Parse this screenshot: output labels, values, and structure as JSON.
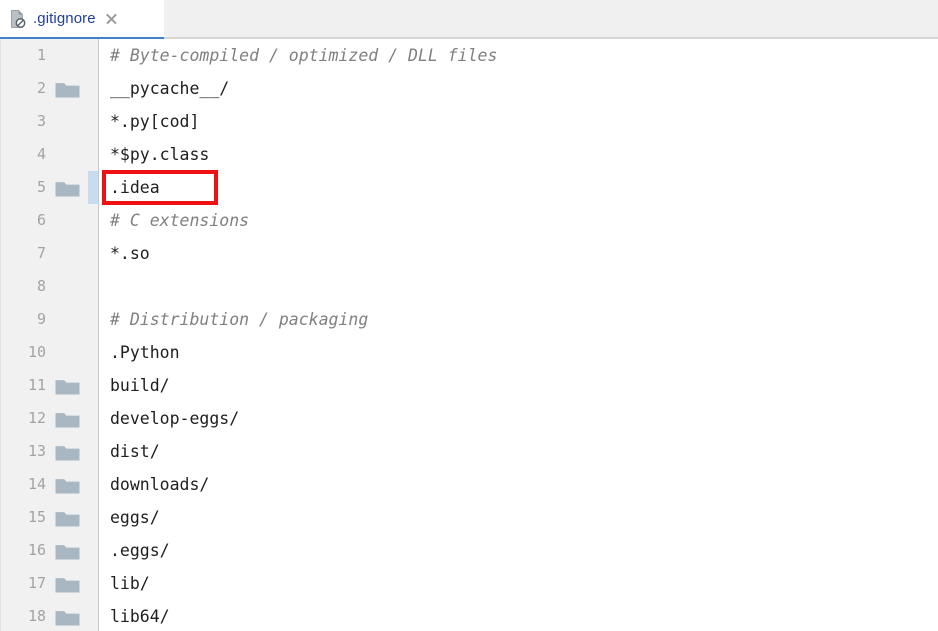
{
  "window": {
    "title": ".gitignore"
  },
  "tabbar": {
    "tabs": [
      {
        "label": ".gitignore",
        "icon": "ignored-file-icon",
        "active": true,
        "close_icon": "close-icon"
      }
    ]
  },
  "editor": {
    "filename": ".gitignore",
    "language": "ignore",
    "colors": {
      "tab_label": "#1f3f99",
      "tab_active_underline": "#4183c4",
      "gutter_background": "#f1f1f1",
      "line_number": "#a3a3a3",
      "code_text": "#202020",
      "comment_text": "#808080",
      "folder_icon": "#a9b7c2",
      "gutter_highlight_strip": "#c8dcf0",
      "annotation_box": "#ee1111",
      "editor_background": "#ffffff"
    },
    "lines": [
      {
        "number": "1",
        "text": "# Byte-compiled / optimized / DLL files",
        "comment": true,
        "folder": false
      },
      {
        "number": "2",
        "text": "__pycache__/",
        "comment": false,
        "folder": true
      },
      {
        "number": "3",
        "text": "*.py[cod]",
        "comment": false,
        "folder": false
      },
      {
        "number": "4",
        "text": "*$py.class",
        "comment": false,
        "folder": false
      },
      {
        "number": "5",
        "text": ".idea",
        "comment": false,
        "folder": true
      },
      {
        "number": "6",
        "text": "# C extensions",
        "comment": true,
        "folder": false
      },
      {
        "number": "7",
        "text": "*.so",
        "comment": false,
        "folder": false
      },
      {
        "number": "8",
        "text": "",
        "comment": false,
        "folder": false
      },
      {
        "number": "9",
        "text": "# Distribution / packaging",
        "comment": true,
        "folder": false
      },
      {
        "number": "10",
        "text": ".Python",
        "comment": false,
        "folder": false
      },
      {
        "number": "11",
        "text": "build/",
        "comment": false,
        "folder": true
      },
      {
        "number": "12",
        "text": "develop-eggs/",
        "comment": false,
        "folder": true
      },
      {
        "number": "13",
        "text": "dist/",
        "comment": false,
        "folder": true
      },
      {
        "number": "14",
        "text": "downloads/",
        "comment": false,
        "folder": true
      },
      {
        "number": "15",
        "text": "eggs/",
        "comment": false,
        "folder": true
      },
      {
        "number": "16",
        "text": ".eggs/",
        "comment": false,
        "folder": true
      },
      {
        "number": "17",
        "text": "lib/",
        "comment": false,
        "folder": true
      },
      {
        "number": "18",
        "text": "lib64/",
        "comment": false,
        "folder": true
      }
    ]
  },
  "annotation": {
    "target_line": "5",
    "target_text": ".idea",
    "shape": "rectangle",
    "color": "#ee1111"
  }
}
